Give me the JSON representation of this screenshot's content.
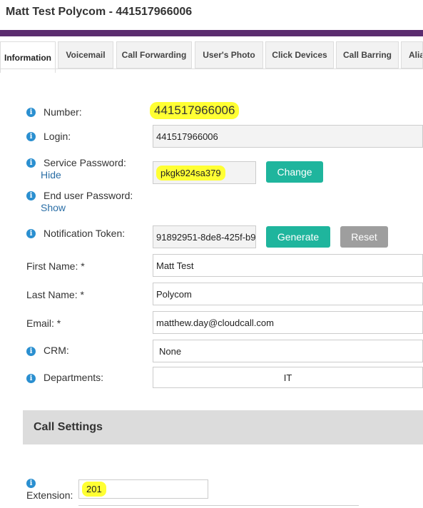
{
  "title": "Matt Test Polycom - 441517966006",
  "tabs": [
    {
      "label": "Information"
    },
    {
      "label": "Voicemail"
    },
    {
      "label": "Call Forwarding"
    },
    {
      "label": "User's Photo"
    },
    {
      "label": "Click Devices"
    },
    {
      "label": "Call Barring"
    },
    {
      "label": "Alia"
    }
  ],
  "form": {
    "number_label": "Number:",
    "number_value": "441517966006",
    "login_label": "Login:",
    "login_value": "441517966006",
    "service_password_label": "Service Password:",
    "service_password_toggle": "Hide",
    "service_password_value": "pkgk924sa379",
    "change_button": "Change",
    "end_user_password_label": "End user Password:",
    "end_user_password_toggle": "Show",
    "notification_token_label": "Notification Token:",
    "notification_token_value": "91892951-8de8-425f-b9e",
    "generate_button": "Generate",
    "reset_button": "Reset",
    "first_name_label": "First Name: *",
    "first_name_value": "Matt Test",
    "last_name_label": "Last Name: *",
    "last_name_value": "Polycom",
    "email_label": "Email: *",
    "email_value": "matthew.day@cloudcall.com",
    "crm_label": "CRM:",
    "crm_value": "None",
    "departments_label": "Departments:",
    "departments_value": "IT"
  },
  "call_settings": {
    "header": "Call Settings",
    "extension_label": "Extension:",
    "extension_value": "201"
  },
  "colors": {
    "brand_bar": "#5b2c6f",
    "primary_button": "#1fb59d",
    "secondary_button": "#9e9e9e",
    "info_icon": "#2a8fd0",
    "highlight": "#ffff33"
  },
  "icons": {
    "info": "info-circle-icon"
  }
}
